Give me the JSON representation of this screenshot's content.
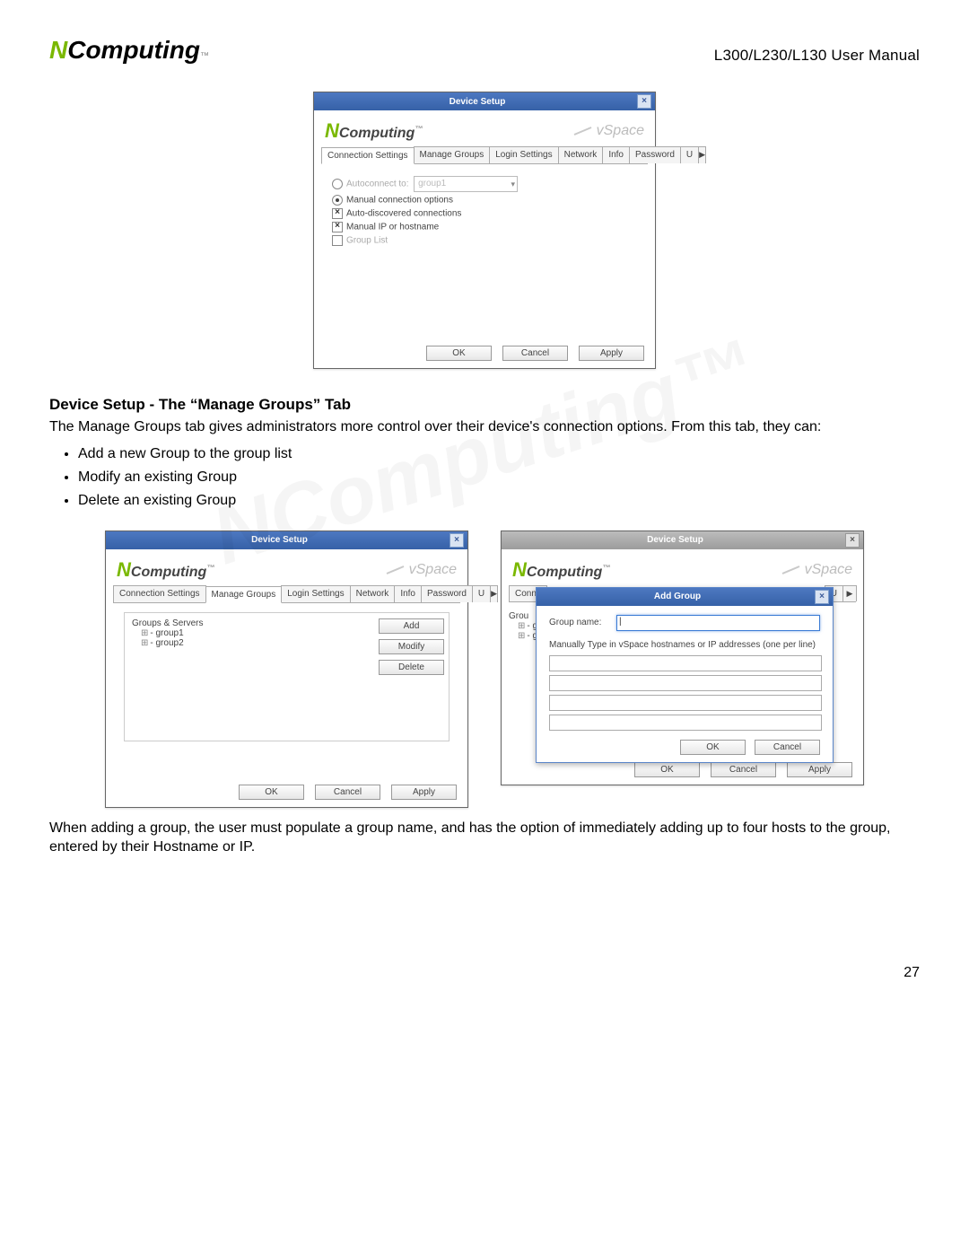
{
  "header": {
    "logo_n": "N",
    "logo_rest": "Computing",
    "logo_tm": "™",
    "doc_title": "L300/L230/L130 User Manual"
  },
  "screenshot1": {
    "window_title": "Device Setup",
    "logo_n": "N",
    "logo_rest": "Computing",
    "logo_tm": "™",
    "space_label": "vSpace",
    "tabs": {
      "connection_settings": "Connection Settings",
      "manage_groups": "Manage Groups",
      "login_settings": "Login Settings",
      "network": "Network",
      "info": "Info",
      "password": "Password",
      "u": "U"
    },
    "autoconnect_label": "Autoconnect to:",
    "autoconnect_value": "group1",
    "manual_options": "Manual connection options",
    "auto_discovered": "Auto-discovered connections",
    "manual_ip": "Manual IP or hostname",
    "group_list": "Group List",
    "buttons": {
      "ok": "OK",
      "cancel": "Cancel",
      "apply": "Apply"
    }
  },
  "section": {
    "heading": "Device Setup - The “Manage Groups” Tab",
    "intro": "The Manage Groups tab gives administrators more control over their device's connection options. From this tab, they can:",
    "bullets": {
      "b1": "Add a new Group to the group list",
      "b2": "Modify an existing Group",
      "b3": "Delete an existing Group"
    },
    "followup": "When adding a group, the user must populate a group name, and has the option of immediately adding up to four hosts to the group, entered by their Hostname or IP."
  },
  "screenshot2": {
    "window_title": "Device Setup",
    "groups_header": "Groups & Servers",
    "group1": "group1",
    "group2": "group2",
    "add": "Add",
    "modify": "Modify",
    "delete": "Delete",
    "buttons": {
      "ok": "OK",
      "cancel": "Cancel",
      "apply": "Apply"
    }
  },
  "screenshot3": {
    "window_title": "Device Setup",
    "conne": "Conne",
    "u": "U",
    "grou": "Grou",
    "modal_title": "Add Group",
    "group_name_label": "Group name:",
    "instruction": "Manually Type in vSpace hostnames or IP addresses (one per line)",
    "modal_ok": "OK",
    "modal_cancel": "Cancel",
    "buttons": {
      "ok": "OK",
      "cancel": "Cancel",
      "apply": "Apply"
    }
  },
  "page_number": "27",
  "watermark": "NComputing™"
}
